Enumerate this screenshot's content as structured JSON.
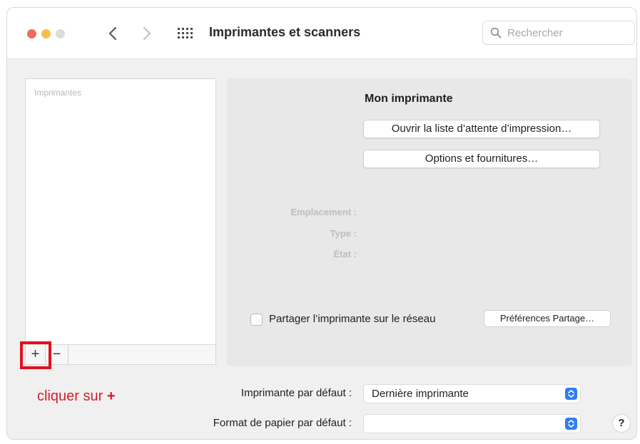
{
  "window": {
    "title": "Imprimantes et scanners"
  },
  "toolbar": {
    "back_icon": "chevron-left-icon",
    "forward_icon": "chevron-right-icon",
    "grid_icon": "grid-icon"
  },
  "search": {
    "placeholder": "Rechercher"
  },
  "printer_list": {
    "header": "Imprimantes",
    "add_label": "+",
    "remove_label": "−"
  },
  "details": {
    "printer_name": "Mon imprimante",
    "open_queue_label": "Ouvrir la liste d’attente d’impression…",
    "options_label": "Options et fournitures…",
    "location_label": "Emplacement :",
    "type_label": "Type :",
    "state_label": "État :",
    "share_label": "Partager l’imprimante sur le réseau",
    "share_checked": false,
    "share_prefs_label": "Préférences Partage…"
  },
  "annotation": {
    "text": "cliquer sur ",
    "plus": "+",
    "color": "#e0121f"
  },
  "defaults": {
    "default_printer_label": "Imprimante par défaut :",
    "default_printer_value": "Dernière imprimante",
    "paper_format_label": "Format de papier par défaut :",
    "paper_format_value": ""
  },
  "help": {
    "label": "?"
  },
  "colors": {
    "close": "#ed6b5f",
    "minimize": "#f5bf4f",
    "zoom_disabled": "#dcdcdc",
    "accent": "#2f7cf6"
  }
}
